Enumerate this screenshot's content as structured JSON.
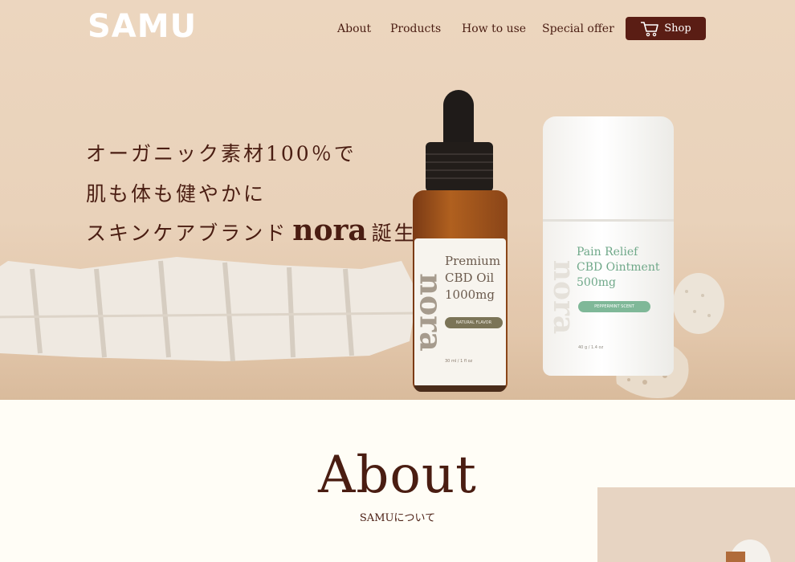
{
  "header": {
    "logo": "SAMU",
    "nav": [
      "About",
      "Products",
      "How to use",
      "Special offer"
    ],
    "shop_label": "Shop"
  },
  "hero": {
    "line1": "オーガニック素材100％で",
    "line2": "肌も体も健やかに",
    "line3_prefix": "スキンケアブランド",
    "line3_brand": "nora",
    "line3_suffix": "誕生",
    "bottle": {
      "brand": "nora",
      "line1": "Premium",
      "line2": "CBD Oil",
      "line3": "1000mg",
      "tag": "NATURAL FLAVOR",
      "volume": "30 ml / 1 fl oz"
    },
    "jar": {
      "brand": "nora",
      "line1": "Pain Relief",
      "line2": "CBD Ointment",
      "line3": "500mg",
      "tag": "PEPPERMINT SCENT",
      "volume": "40 g / 1.4 oz"
    }
  },
  "about": {
    "title": "About",
    "subtitle": "SAMUについて"
  },
  "colors": {
    "brand_dark": "#5a1d14",
    "text_primary": "#4a1d12",
    "hero_bg": "#ecd6bf",
    "page_bg": "#fffdf6"
  },
  "icons": [
    "cart-icon"
  ]
}
